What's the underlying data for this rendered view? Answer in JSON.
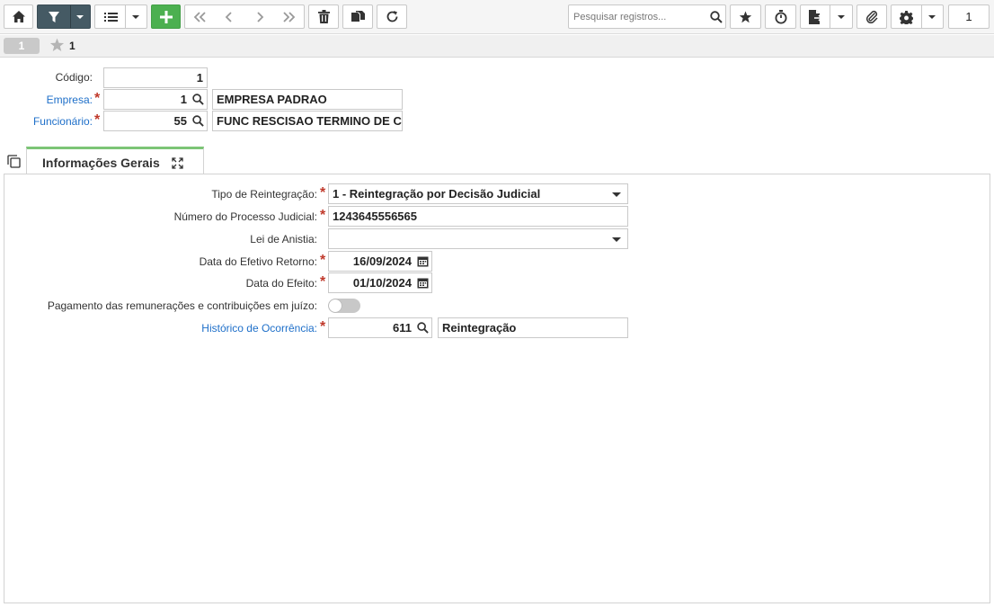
{
  "toolbar": {
    "search_placeholder": "Pesquisar registros...",
    "page_number": "1",
    "buttons": [
      "home-icon",
      "filter-icon",
      "list-icon",
      "add-icon",
      "first-icon",
      "previous-icon",
      "next-icon",
      "last-icon",
      "delete-icon",
      "copy-icon",
      "refresh-icon",
      "favorite-icon",
      "timer-icon",
      "report-icon",
      "attach-icon",
      "settings-icon"
    ],
    "colors": {
      "filter_bg": "#455a64",
      "add_bg": "#4cb050"
    }
  },
  "record_tabs": {
    "current_pill": "1",
    "favorite_label": "1"
  },
  "header": {
    "codigo_label": "Código:",
    "codigo_value": "1",
    "empresa_label": "Empresa:",
    "empresa_code": "1",
    "empresa_desc": "EMPRESA PADRAO",
    "funcionario_label": "Funcionário:",
    "funcionario_code": "55",
    "funcionario_desc": "FUNC RESCISAO TERMINO DE C"
  },
  "tabs": [
    {
      "label": "Informações Gerais",
      "active": true
    }
  ],
  "form": {
    "tipo_label": "Tipo de Reintegração:",
    "tipo_value": "1 - Reintegração por Decisão Judicial",
    "processo_label": "Número do Processo Judicial:",
    "processo_value": "1243645556565",
    "lei_label": "Lei de Anistia:",
    "lei_value": "",
    "retorno_label": "Data do Efetivo Retorno:",
    "retorno_value": "16/09/2024",
    "efeito_label": "Data do Efeito:",
    "efeito_value": "01/10/2024",
    "pagamento_label": "Pagamento das remunerações e contribuições em juízo:",
    "pagamento_on": false,
    "historico_label": "Histórico de Ocorrência:",
    "historico_code": "611",
    "historico_desc": "Reintegração"
  },
  "required_color": "#c0392b",
  "link_color": "#1e6fc9"
}
